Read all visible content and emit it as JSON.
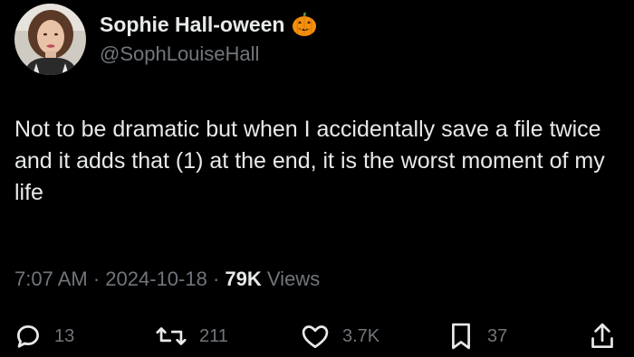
{
  "author": {
    "display_name": "Sophie Hall-oween",
    "name_emoji": "pumpkin-icon",
    "handle": "@SophLouiseHall"
  },
  "tweet": {
    "text": "Not to be dramatic but when I accidentally save a file twice and it adds that (1) at the end, it is the worst moment of my life",
    "time": "7:07 AM",
    "separator": "·",
    "date": "2024-10-18",
    "views_count": "79K",
    "views_label": "Views"
  },
  "actions": {
    "replies": "13",
    "reposts": "211",
    "likes": "3.7K",
    "bookmarks": "37"
  },
  "colors": {
    "background": "#000000",
    "primary_text": "#e7e9ea",
    "secondary_text": "#71767b",
    "pumpkin": "#f4900c"
  }
}
